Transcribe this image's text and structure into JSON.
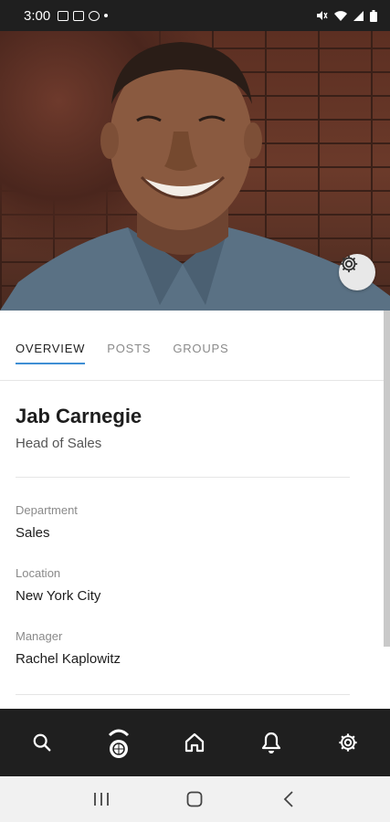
{
  "status_bar": {
    "time": "3:00",
    "left_icons": [
      "image-icon",
      "mail-icon",
      "app-icon"
    ],
    "right_icons": [
      "mute-icon",
      "wifi-icon",
      "signal-icon",
      "battery-icon"
    ]
  },
  "hero": {
    "description_icon": "profile-photo",
    "settings_icon": "gear-icon"
  },
  "tabs": [
    {
      "label": "OVERVIEW",
      "active": true
    },
    {
      "label": "POSTS",
      "active": false
    },
    {
      "label": "GROUPS",
      "active": false
    }
  ],
  "profile": {
    "name": "Jab Carnegie",
    "title": "Head of Sales",
    "fields": [
      {
        "label": "Department",
        "value": "Sales"
      },
      {
        "label": "Location",
        "value": "New York City"
      },
      {
        "label": "Manager",
        "value": "Rachel Kaplowitz"
      }
    ]
  },
  "bottom_nav": {
    "items": [
      "search-icon",
      "brand-icon",
      "home-icon",
      "bell-icon",
      "gear-icon"
    ]
  },
  "colors": {
    "accent": "#3f8fd4",
    "nav_bg": "#1f1f1f"
  }
}
